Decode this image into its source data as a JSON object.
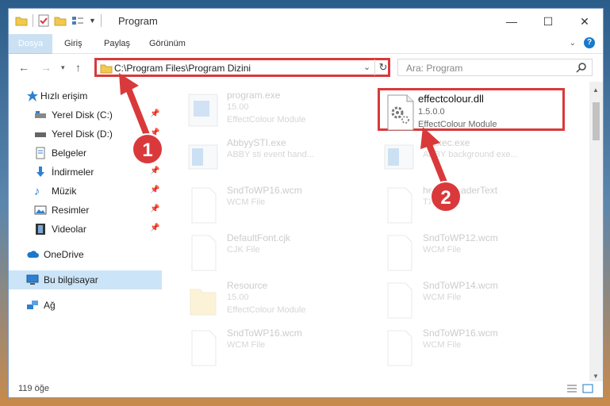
{
  "window": {
    "title": "Program",
    "controls": {
      "minimize": "—",
      "maximize": "☐",
      "close": "✕"
    }
  },
  "ribbon": {
    "tabs": [
      "Dosya",
      "Giriş",
      "Paylaş",
      "Görünüm"
    ],
    "help": "?"
  },
  "navigation": {
    "address": "C:\\Program Files\\Program Dizini",
    "search_placeholder": "Ara: Program"
  },
  "sidebar": {
    "quick_access": "Hızlı erişim",
    "items": [
      "Yerel Disk (C:)",
      "Yerel Disk (D:)",
      "Belgeler",
      "İndirmeler",
      "Müzik",
      "Resimler",
      "Videolar"
    ],
    "onedrive": "OneDrive",
    "this_pc": "Bu bilgisayar",
    "network": "Ağ"
  },
  "files": [
    {
      "name": "program.exe",
      "meta": "15.00",
      "desc": "EffectColour Module"
    },
    {
      "name": "effectcolour.dll",
      "meta": "1.5.0.0",
      "desc": "EffectColour Module"
    },
    {
      "name": "AbbyySTI.exe",
      "meta": "ABBY sti event hand...",
      "desc": ""
    },
    {
      "name": "...Exec.exe",
      "meta": "ABBY background exe...",
      "desc": ""
    },
    {
      "name": "SndToWP16.wcm",
      "meta": "WCM File",
      "desc": ""
    },
    {
      "name": "help...ReaderText",
      "meta": "TXT File",
      "desc": ""
    },
    {
      "name": "DefaultFont.cjk",
      "meta": "CJK File",
      "desc": ""
    },
    {
      "name": "SndToWP12.wcm",
      "meta": "WCM File",
      "desc": ""
    },
    {
      "name": "Resource",
      "meta": "15.00",
      "desc": "EffectColour Module"
    },
    {
      "name": "SndToWP14.wcm",
      "meta": "WCM File",
      "desc": ""
    },
    {
      "name": "SndToWP16.wcm",
      "meta": "WCM File",
      "desc": ""
    },
    {
      "name": "SndToWP16.wcm",
      "meta": "WCM File",
      "desc": ""
    }
  ],
  "status": {
    "count": "119 öğe"
  },
  "callouts": [
    "1",
    "2"
  ],
  "colors": {
    "accent": "#1979ca",
    "highlight": "#d9393b"
  }
}
